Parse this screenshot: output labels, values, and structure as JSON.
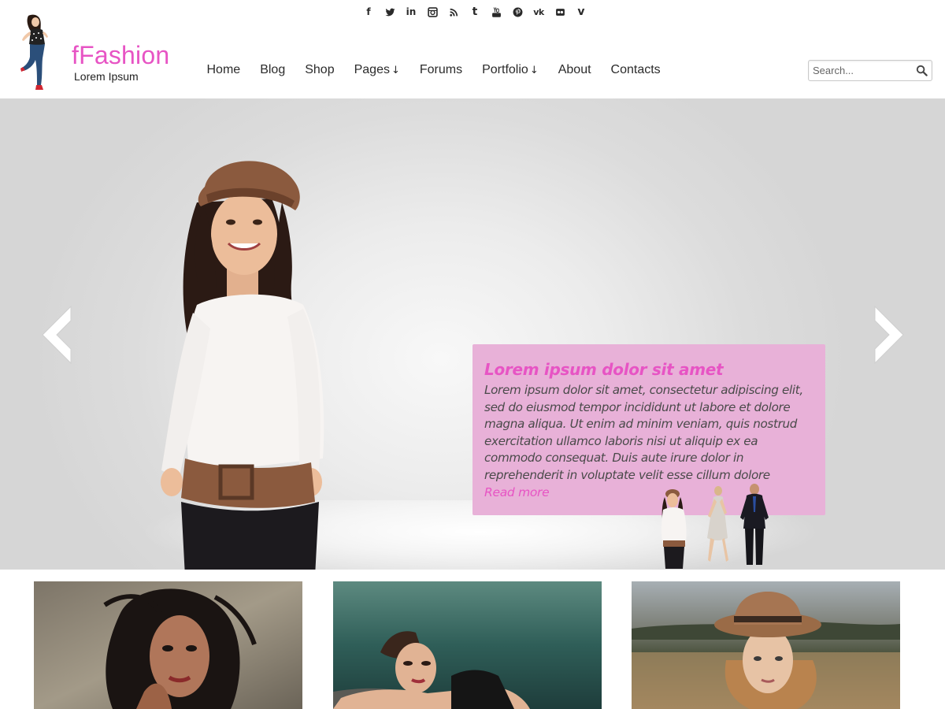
{
  "social": [
    {
      "name": "facebook-icon",
      "glyph": "f"
    },
    {
      "name": "twitter-icon",
      "glyph": ""
    },
    {
      "name": "linkedin-icon",
      "glyph": "in"
    },
    {
      "name": "instagram-icon",
      "glyph": ""
    },
    {
      "name": "rss-icon",
      "glyph": ""
    },
    {
      "name": "tumblr-icon",
      "glyph": "t"
    },
    {
      "name": "youtube-icon",
      "glyph": ""
    },
    {
      "name": "pinterest-icon",
      "glyph": ""
    },
    {
      "name": "vk-icon",
      "glyph": "vk"
    },
    {
      "name": "flickr-icon",
      "glyph": ""
    },
    {
      "name": "vine-icon",
      "glyph": "v"
    }
  ],
  "brand": {
    "title": "fFashion",
    "tagline": "Lorem Ipsum",
    "color": "#e754c4"
  },
  "nav": {
    "home": "Home",
    "blog": "Blog",
    "shop": "Shop",
    "pages": "Pages",
    "forums": "Forums",
    "portfolio": "Portfolio",
    "about": "About",
    "contacts": "Contacts",
    "dropdown_arrow": "↓"
  },
  "search": {
    "placeholder": "Search..."
  },
  "slider": {
    "caption_title": "Lorem ipsum dolor sit amet",
    "caption_text": "Lorem ipsum dolor sit amet, consectetur adipiscing elit, sed do eiusmod tempor incididunt ut labore et dolore magna aliqua. Ut enim ad minim veniam, quis nostrud exercitation ullamco laboris nisi ut aliquip ex ea commodo consequat. Duis aute irure dolor in reprehenderit in voluptate velit esse cillum dolore",
    "read_more": "Read more",
    "caption_bg": "#e8b1d8"
  },
  "gallery": [
    {
      "name": "gallery-card-1"
    },
    {
      "name": "gallery-card-2"
    },
    {
      "name": "gallery-card-3"
    }
  ]
}
